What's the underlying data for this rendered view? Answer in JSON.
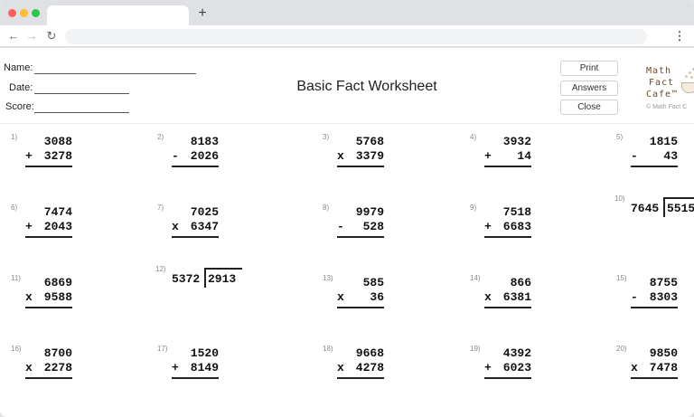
{
  "browser": {
    "new_tab_glyph": "+",
    "back_glyph": "←",
    "forward_glyph": "→",
    "reload_glyph": "↻",
    "menu_glyph": "⋮"
  },
  "header": {
    "name_label": "Name:",
    "date_label": "Date:",
    "score_label": "Score:",
    "title": "Basic Fact Worksheet",
    "print_label": "Print",
    "answers_label": "Answers",
    "close_label": "Close"
  },
  "logo": {
    "line1": "Math",
    "line2": "Fact",
    "line3": "Cafe™",
    "copyright": "© Math Fact C"
  },
  "problems": [
    {
      "num": "1)",
      "type": "add",
      "top": "3088",
      "bottom": "3278",
      "op": "+"
    },
    {
      "num": "2)",
      "type": "sub",
      "top": "8183",
      "bottom": "2026",
      "op": "-"
    },
    {
      "num": "3)",
      "type": "mul",
      "top": "5768",
      "bottom": "3379",
      "op": "x"
    },
    {
      "num": "4)",
      "type": "add",
      "top": "3932",
      "bottom": "14",
      "op": "+"
    },
    {
      "num": "5)",
      "type": "sub",
      "top": "1815",
      "bottom": "43",
      "op": "-"
    },
    {
      "num": "6)",
      "type": "add",
      "top": "7474",
      "bottom": "2043",
      "op": "+"
    },
    {
      "num": "7)",
      "type": "mul",
      "top": "7025",
      "bottom": "6347",
      "op": "x"
    },
    {
      "num": "8)",
      "type": "sub",
      "top": "9979",
      "bottom": "528",
      "op": "-"
    },
    {
      "num": "9)",
      "type": "add",
      "top": "7518",
      "bottom": "6683",
      "op": "+"
    },
    {
      "num": "10)",
      "type": "div",
      "divisor": "7645",
      "dividend": "5515"
    },
    {
      "num": "11)",
      "type": "mul",
      "top": "6869",
      "bottom": "9588",
      "op": "x"
    },
    {
      "num": "12)",
      "type": "div",
      "divisor": "5372",
      "dividend": "2913"
    },
    {
      "num": "13)",
      "type": "mul",
      "top": "585",
      "bottom": "36",
      "op": "x"
    },
    {
      "num": "14)",
      "type": "mul",
      "top": "866",
      "bottom": "6381",
      "op": "x"
    },
    {
      "num": "15)",
      "type": "sub",
      "top": "8755",
      "bottom": "8303",
      "op": "-"
    },
    {
      "num": "16)",
      "type": "mul",
      "top": "8700",
      "bottom": "2278",
      "op": "x"
    },
    {
      "num": "17)",
      "type": "add",
      "top": "1520",
      "bottom": "8149",
      "op": "+"
    },
    {
      "num": "18)",
      "type": "mul",
      "top": "9668",
      "bottom": "4278",
      "op": "x"
    },
    {
      "num": "19)",
      "type": "add",
      "top": "4392",
      "bottom": "6023",
      "op": "+"
    },
    {
      "num": "20)",
      "type": "mul",
      "top": "9850",
      "bottom": "7478",
      "op": "x"
    }
  ]
}
